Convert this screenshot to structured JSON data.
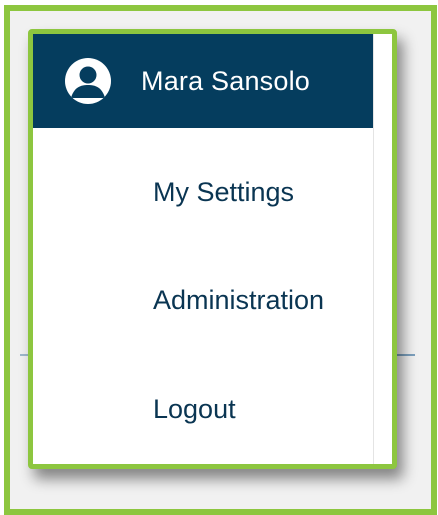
{
  "user_menu": {
    "user_name": "Mara Sansolo",
    "avatar_icon": "user-circle-icon",
    "items": [
      {
        "label": "My Settings"
      },
      {
        "label": "Administration"
      },
      {
        "label": "Logout"
      }
    ]
  },
  "colors": {
    "header_bg": "#053d5e",
    "highlight_border": "#8dc63f",
    "item_text": "#0a3552"
  }
}
